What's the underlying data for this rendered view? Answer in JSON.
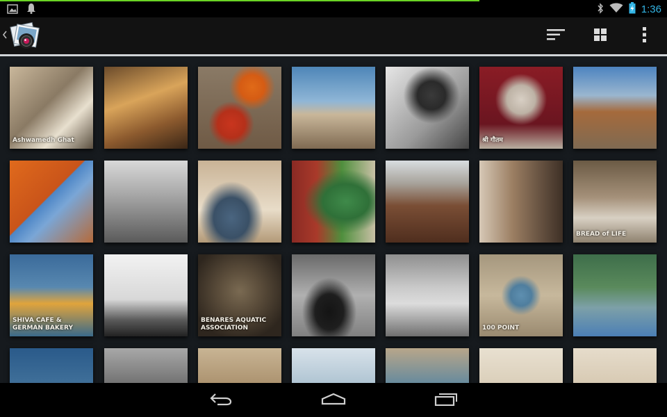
{
  "status_bar": {
    "time": "1:36",
    "icons": [
      "image-notification-icon",
      "bell-notification-icon",
      "bluetooth-icon",
      "wifi-icon",
      "battery-charging-icon"
    ]
  },
  "action_bar": {
    "app_icon": "camera-photos-app-icon",
    "actions": [
      "sort-icon",
      "grid-view-icon",
      "overflow-menu-icon"
    ]
  },
  "photos": {
    "rows": [
      [
        {
          "label": "Ashwamedh Ghat",
          "bg": "linear-gradient(135deg,#c9b79b 0%,#8a7a64 45%,#e8e0cf 70%,#5b4f40 100%)"
        },
        {
          "label": "",
          "bg": "linear-gradient(160deg,#6b4b2b 0%,#d9a45a 40%,#8c5a2e 70%,#3a2616 100%)"
        },
        {
          "label": "",
          "bg": "radial-gradient(circle at 40% 70%,#c9351e 0,#b5301a 18%,transparent 30%),radial-gradient(circle at 65% 25%,#e06a18 0,#d55c14 15%,transparent 28%),linear-gradient(180deg,#8a7a66,#6f5a45)"
        },
        {
          "label": "",
          "bg": "linear-gradient(180deg,#4e86b8 0%,#8fb6d6 42%,#c9b79a 58%,#7f6a52 100%)"
        },
        {
          "label": "",
          "bg": "radial-gradient(circle at 55% 35%,#3a3a3a 0,#2a2a2a 20%,transparent 40%),linear-gradient(135deg,#e6e6e6,#9a9a9a 60%,#444)"
        },
        {
          "label": "श्री गौतम",
          "bg": "radial-gradient(circle at 50% 40%,#d8cfc4 0,#bdb2a5 22%,transparent 40%),linear-gradient(180deg,#8a1c25,#6a1520 70%,#b8aea0)"
        },
        {
          "label": "",
          "bg": "linear-gradient(180deg,#4d84c0 0%,#9ab6cf 35%,#a56a3c 55%,#7f6a52 100%)"
        }
      ],
      [
        {
          "label": "",
          "bg": "linear-gradient(135deg,#e06a1c 0%,#c9541a 45%,#4d86c6 46%,#7aa6d6 60%,#b56a3a 100%)"
        },
        {
          "label": "",
          "bg": "linear-gradient(180deg,#d9d9d9 0%,#a3a3a3 45%,#5a5a5a 100%)"
        },
        {
          "label": "",
          "bg": "radial-gradient(ellipse at 40% 70%,#4a6580 0,#3a5066 25%,transparent 45%),linear-gradient(180deg,#c9b396,#e8dcc8 60%,#b39a78)"
        },
        {
          "label": "",
          "bg": "radial-gradient(ellipse at 65% 50%,#3f8a4a 0,#2f7038 30%,transparent 55%),linear-gradient(90deg,#8a2a24,#a93a2a 30%,#4f8f3d 60%,#c9c0a6)"
        },
        {
          "label": "",
          "bg": "linear-gradient(180deg,#d8dde0 0%,#a7a29a 28%,#7a4e35 55%,#4f2e1e 100%)"
        },
        {
          "label": "",
          "bg": "linear-gradient(90deg,#d6c8b6 0%,#9b7e62 40%,#6b5644 70%,#3e3026 100%)"
        },
        {
          "label": "BREAD of LIFE",
          "bg": "linear-gradient(180deg,#6b5a44 0%,#a5917a 45%,#d8d0c3 70%,#8f826f 100%)"
        }
      ],
      [
        {
          "label": "SHIVA CAFE & GERMAN BAKERY",
          "bg": "linear-gradient(180deg,#3a6a9a 0%,#5888b0 40%,#e0a43c 60%,#3a6a8a 100%)"
        },
        {
          "label": "",
          "bg": "linear-gradient(180deg,#f2f2f2 0%,#d8d8d8 55%,#5a5a5a 80%,#222 100%)"
        },
        {
          "label": "BENARES AQUATIC ASSOCIATION",
          "bg": "radial-gradient(circle at 50% 45%,#7a6a52 0,#5a4c3a 35%,#2e261e 80%)"
        },
        {
          "label": "",
          "bg": "radial-gradient(ellipse at 45% 70%,#141414 0,#1e1e1e 22%,transparent 42%),linear-gradient(180deg,#6a6a6a,#b0b0b0 50%,#808080)"
        },
        {
          "label": "",
          "bg": "linear-gradient(180deg,#8f8f8f 0%,#c9c9c9 40%,#dcdcdc 60%,#6f6f6f 100%)"
        },
        {
          "label": "100 POINT",
          "bg": "radial-gradient(circle at 50% 50%,#5e8fb0 0,#4f7e9e 18%,transparent 34%),linear-gradient(180deg,#a5977e,#c7b89c 50%,#9a8a70)"
        },
        {
          "label": "",
          "bg": "linear-gradient(180deg,#3e6e4a 0%,#5a8a5c 40%,#7da0a8 65%,#4b7fb5 100%)"
        }
      ],
      [
        {
          "label": "",
          "bg": "linear-gradient(180deg,#2a5a8a 0%,#3e6e98 40%,#7a3a2a 100%)"
        },
        {
          "label": "",
          "bg": "linear-gradient(180deg,#a8a8a8 0%,#6a6a6a 50%,#2e2e2e 100%)"
        },
        {
          "label": "",
          "bg": "linear-gradient(180deg,#c8b494 0%,#a88e6a 50%,#6e5840 100%)"
        },
        {
          "label": "",
          "bg": "linear-gradient(180deg,#d8e2ea 0%,#a9c0cf 50%,#4e6a4a 100%)"
        },
        {
          "label": "",
          "bg": "linear-gradient(180deg,#b8a68a 0%,#5a86a0 50%,#8a7a62 100%)"
        },
        {
          "label": "",
          "bg": "linear-gradient(180deg,#e8e0d0 0%,#d6c9b2 60%,#a8987e 100%)"
        },
        {
          "label": "",
          "bg": "linear-gradient(180deg,#e6dccb 0%,#d2c3aa 60%,#8a7a64 100%)"
        }
      ]
    ]
  },
  "nav_bar": {
    "buttons": [
      "back-icon",
      "home-icon",
      "recent-apps-icon"
    ]
  }
}
